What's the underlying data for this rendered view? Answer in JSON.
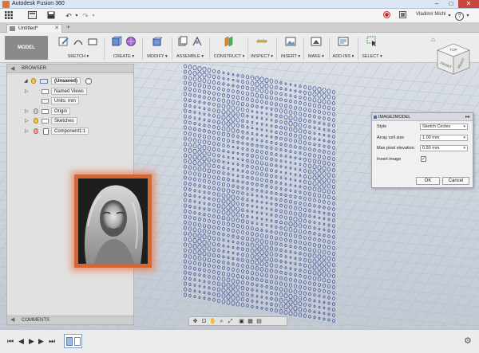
{
  "window": {
    "title": "Autodesk Fusion 360",
    "minimize_glyph": "–",
    "maximize_glyph": "□",
    "close_glyph": "✕"
  },
  "appbar": {
    "user_name": "Vladimir Michl",
    "user_dropdown_glyph": "▾",
    "help_glyph": "?",
    "help_dropdown_glyph": "▾"
  },
  "tab": {
    "document_title": "Untitled*",
    "close_glyph": "✕",
    "add_glyph": "+"
  },
  "ribbon": {
    "workspace": "MODEL",
    "groups": [
      {
        "label": "SKETCH ▾"
      },
      {
        "label": "CREATE ▾"
      },
      {
        "label": "MODIFY ▾"
      },
      {
        "label": "ASSEMBLE ▾"
      },
      {
        "label": "CONSTRUCT ▾"
      },
      {
        "label": "INSPECT ▾"
      },
      {
        "label": "INSERT ▾"
      },
      {
        "label": "MAKE ▾"
      },
      {
        "label": "ADD-INS ▾"
      },
      {
        "label": "SELECT ▾"
      }
    ]
  },
  "browser": {
    "title": "BROWSER",
    "root_label": "(Unsaved)",
    "items": [
      {
        "label": "Named Views"
      },
      {
        "label": "Units: mm"
      },
      {
        "label": "Origin"
      },
      {
        "label": "Sketches"
      },
      {
        "label": "Component1:1"
      }
    ]
  },
  "comments": {
    "title": "COMMENTS"
  },
  "viewcube": {
    "top": "TOP",
    "front": "FRONT",
    "right": "RIGHT"
  },
  "dialog": {
    "title": "IMAGE2MODEL",
    "more_glyph": "▸▸",
    "style_label": "Style",
    "style_value": "Sketch Circles",
    "array_cell_label": "Array cell size",
    "array_cell_value": "1.00 mm",
    "max_pixel_label": "Max pixel elevation",
    "max_pixel_value": "0.50 mm",
    "invert_label": "Invert image",
    "invert_checked": true,
    "ok_label": "OK",
    "cancel_label": "Cancel"
  },
  "navbar": {
    "icons": [
      "orbit-icon",
      "look-at-icon",
      "pan-icon",
      "zoom-icon",
      "fit-icon",
      "display-mode-icon",
      "grid-icon",
      "viewports-icon"
    ]
  },
  "timeline": {
    "controls": [
      "⏮",
      "◀",
      "▶",
      "▶",
      "⏭"
    ]
  },
  "colors": {
    "accent_orange": "#d9662c",
    "circle_blue": "#3c4f96"
  }
}
